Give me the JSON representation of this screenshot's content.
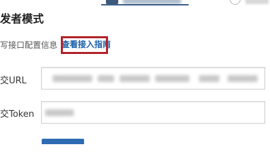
{
  "title": "发者模式",
  "config": {
    "description": "写接口配置信息",
    "guide_link": "查看接入指南"
  },
  "fields": {
    "url_label": "交URL",
    "token_label": "交Token"
  },
  "colors": {
    "highlight_box": "#b12228",
    "link": "#1a5fa8",
    "primary_button": "#2d6bb3"
  }
}
